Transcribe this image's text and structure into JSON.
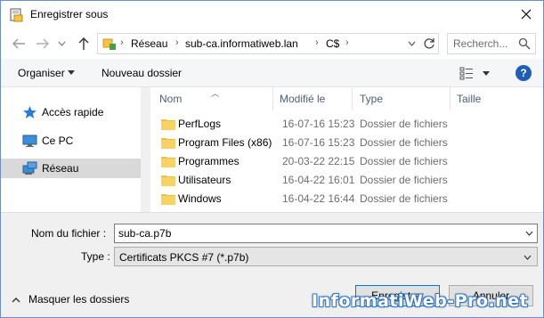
{
  "window": {
    "title": "Enregistrer sous"
  },
  "nav": {
    "address_segments": [
      "Réseau",
      "sub-ca.informatiweb.lan",
      "C$"
    ],
    "search_placeholder": "Recherch..."
  },
  "toolbar": {
    "organize_label": "Organiser",
    "new_folder_label": "Nouveau dossier",
    "help_label": "?"
  },
  "sidebar": {
    "items": [
      {
        "label": "Accès rapide",
        "icon": "star-icon",
        "selected": false
      },
      {
        "label": "Ce PC",
        "icon": "computer-icon",
        "selected": false
      },
      {
        "label": "Réseau",
        "icon": "network-icon",
        "selected": true
      }
    ]
  },
  "filelist": {
    "columns": [
      "Nom",
      "Modifié le",
      "Type",
      "Taille"
    ],
    "rows": [
      {
        "name": "PerfLogs",
        "modified": "16-07-16 15:23",
        "type": "Dossier de fichiers"
      },
      {
        "name": "Program Files (x86)",
        "modified": "16-07-16 15:23",
        "type": "Dossier de fichiers"
      },
      {
        "name": "Programmes",
        "modified": "20-03-22 22:15",
        "type": "Dossier de fichiers"
      },
      {
        "name": "Utilisateurs",
        "modified": "16-04-22 16:01",
        "type": "Dossier de fichiers"
      },
      {
        "name": "Windows",
        "modified": "16-04-22 16:44",
        "type": "Dossier de fichiers"
      }
    ]
  },
  "form": {
    "filename_label": "Nom du fichier :",
    "filename_value": "sub-ca.p7b",
    "filetype_label": "Type :",
    "filetype_value": "Certificats PKCS #7 (*.p7b)",
    "hide_folders_label": "Masquer les dossiers",
    "save_label": "Enregistrer",
    "cancel_label": "Annuler"
  },
  "watermark": "InformatiWeb-Pro.net",
  "colors": {
    "accent": "#0078d7",
    "folder": "#f0c040",
    "selected_row": "#d9d9d9"
  }
}
